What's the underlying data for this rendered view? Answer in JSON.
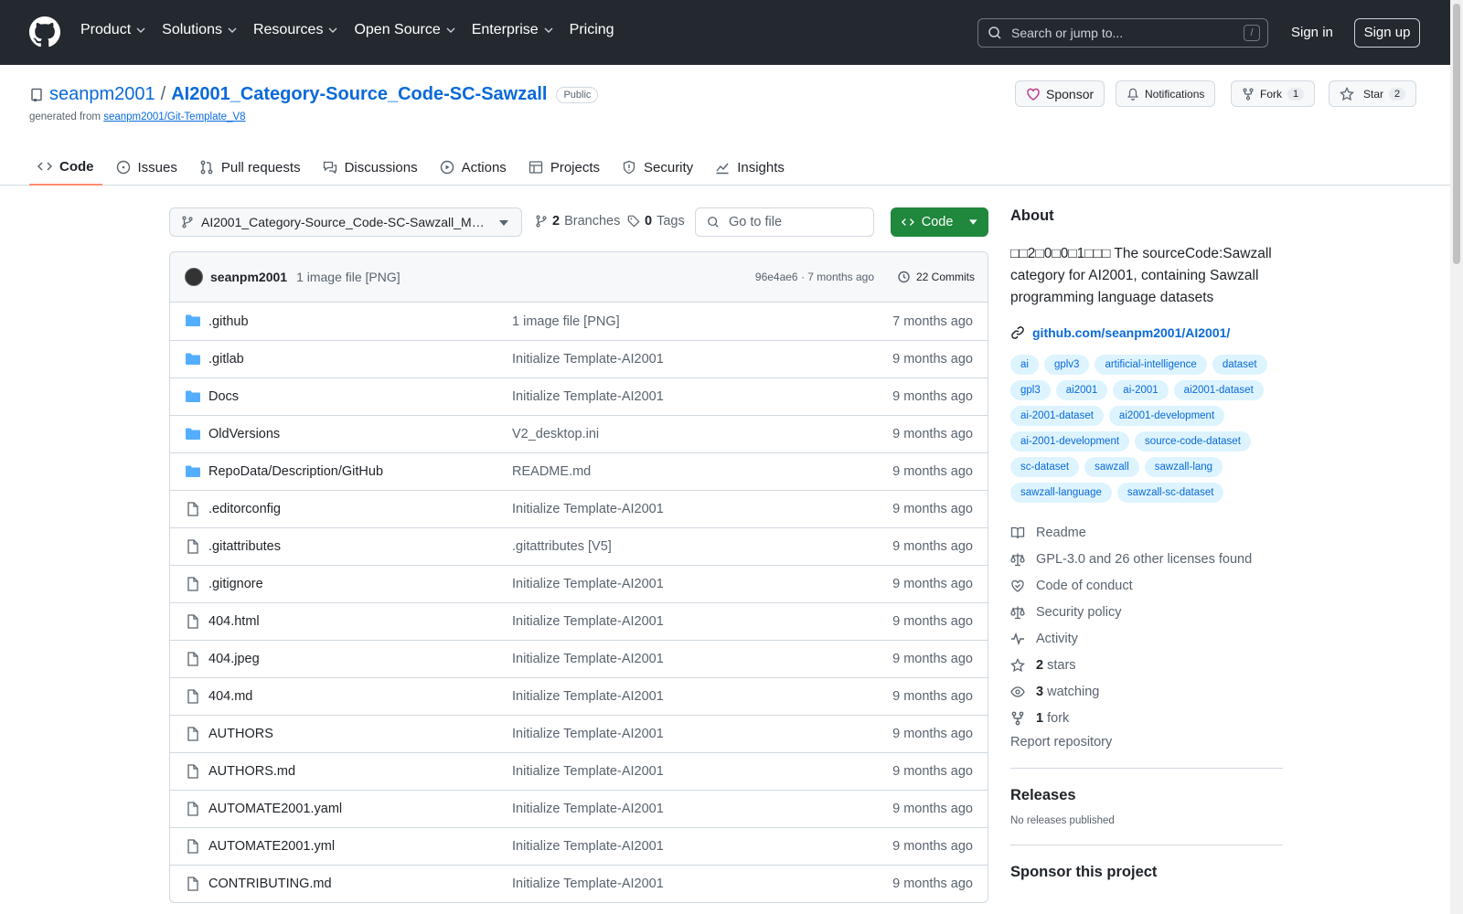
{
  "header": {
    "nav": [
      "Product",
      "Solutions",
      "Resources",
      "Open Source",
      "Enterprise",
      "Pricing"
    ],
    "search_placeholder": "Search or jump to...",
    "search_key": "/",
    "signin": "Sign in",
    "signup": "Sign up"
  },
  "repo": {
    "owner": "seanpm2001",
    "sep": "/",
    "name": "AI2001_Category-Source_Code-SC-Sawzall",
    "visibility": "Public",
    "generated_prefix": "generated from",
    "generated_link": "seanpm2001/Git-Template_V8",
    "sponsor": "Sponsor",
    "notifications": "Notifications",
    "fork": "Fork",
    "fork_count": "1",
    "star": "Star",
    "star_count": "2"
  },
  "tabs": [
    "Code",
    "Issues",
    "Pull requests",
    "Discussions",
    "Actions",
    "Projects",
    "Security",
    "Insights"
  ],
  "toolbar": {
    "branch": "AI2001_Category-Source_Code-SC-Sawzall_M…",
    "branches_count": "2",
    "branches_label": "Branches",
    "tags_count": "0",
    "tags_label": "Tags",
    "goto": "Go to file",
    "code": "Code"
  },
  "commit": {
    "user": "seanpm2001",
    "message": "1 image file [PNG]",
    "hash": "96e4ae6 · 7 months ago",
    "commits": "22 Commits"
  },
  "files": [
    {
      "name": ".github",
      "type": "dir",
      "msg": "1 image file [PNG]",
      "age": "7 months ago"
    },
    {
      "name": ".gitlab",
      "type": "dir",
      "msg": "Initialize Template-AI2001",
      "age": "9 months ago"
    },
    {
      "name": "Docs",
      "type": "dir",
      "msg": "Initialize Template-AI2001",
      "age": "9 months ago"
    },
    {
      "name": "OldVersions",
      "type": "dir",
      "msg": "V2_desktop.ini",
      "age": "9 months ago"
    },
    {
      "name": "RepoData/Description/GitHub",
      "type": "dir",
      "msg": "README.md",
      "age": "9 months ago"
    },
    {
      "name": ".editorconfig",
      "type": "file",
      "msg": "Initialize Template-AI2001",
      "age": "9 months ago"
    },
    {
      "name": ".gitattributes",
      "type": "file",
      "msg": ".gitattributes [V5]",
      "age": "9 months ago"
    },
    {
      "name": ".gitignore",
      "type": "file",
      "msg": "Initialize Template-AI2001",
      "age": "9 months ago"
    },
    {
      "name": "404.html",
      "type": "file",
      "msg": "Initialize Template-AI2001",
      "age": "9 months ago"
    },
    {
      "name": "404.jpeg",
      "type": "file",
      "msg": "Initialize Template-AI2001",
      "age": "9 months ago"
    },
    {
      "name": "404.md",
      "type": "file",
      "msg": "Initialize Template-AI2001",
      "age": "9 months ago"
    },
    {
      "name": "AUTHORS",
      "type": "file",
      "msg": "Initialize Template-AI2001",
      "age": "9 months ago"
    },
    {
      "name": "AUTHORS.md",
      "type": "file",
      "msg": "Initialize Template-AI2001",
      "age": "9 months ago"
    },
    {
      "name": "AUTOMATE2001.yaml",
      "type": "file",
      "msg": "Initialize Template-AI2001",
      "age": "9 months ago"
    },
    {
      "name": "AUTOMATE2001.yml",
      "type": "file",
      "msg": "Initialize Template-AI2001",
      "age": "9 months ago"
    },
    {
      "name": "CONTRIBUTING.md",
      "type": "file",
      "msg": "Initialize Template-AI2001",
      "age": "9 months ago"
    }
  ],
  "about": {
    "title": "About",
    "description": "□□2□0□0□1□□□ The sourceCode:Sawzall category for AI2001, containing Sawzall programming language datasets",
    "link": "github.com/seanpm2001/AI2001/",
    "topics": [
      "ai",
      "gplv3",
      "artificial-intelligence",
      "dataset",
      "gpl3",
      "ai2001",
      "ai-2001",
      "ai2001-dataset",
      "ai-2001-dataset",
      "ai2001-development",
      "ai-2001-development",
      "source-code-dataset",
      "sc-dataset",
      "sawzall",
      "sawzall-lang",
      "sawzall-language",
      "sawzall-sc-dataset"
    ],
    "readme": "Readme",
    "license": "GPL-3.0 and 26 other licenses found",
    "conduct": "Code of conduct",
    "security": "Security policy",
    "activity": "Activity",
    "stars_n": "2",
    "stars": " stars",
    "watching_n": "3",
    "watching": " watching",
    "forks_n": "1",
    "forks": " fork",
    "report": "Report repository"
  },
  "releases": {
    "title": "Releases",
    "none": "No releases published"
  },
  "sponsor_project": "Sponsor this project"
}
